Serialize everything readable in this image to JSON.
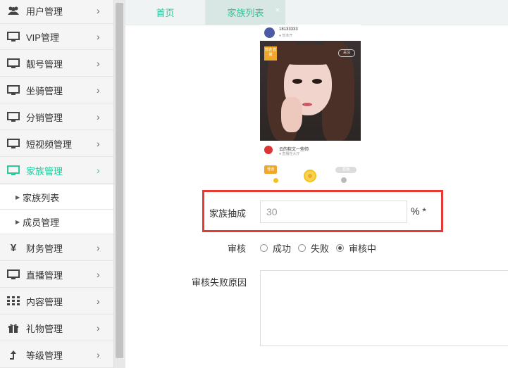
{
  "sidebar": {
    "items": [
      {
        "label": "用户管理",
        "icon": "users-icon"
      },
      {
        "label": "VIP管理",
        "icon": "monitor-icon"
      },
      {
        "label": "靓号管理",
        "icon": "monitor-icon"
      },
      {
        "label": "坐骑管理",
        "icon": "monitor-icon"
      },
      {
        "label": "分销管理",
        "icon": "monitor-icon"
      },
      {
        "label": "短视频管理",
        "icon": "monitor-icon"
      },
      {
        "label": "家族管理",
        "icon": "monitor-icon",
        "active": true
      },
      {
        "label": "财务管理",
        "icon": "yen-icon"
      },
      {
        "label": "直播管理",
        "icon": "monitor-icon"
      },
      {
        "label": "内容管理",
        "icon": "grid-icon"
      },
      {
        "label": "礼物管理",
        "icon": "gift-icon"
      },
      {
        "label": "等级管理",
        "icon": "arrow-up-icon"
      }
    ],
    "sub_items": [
      {
        "label": "家族列表"
      },
      {
        "label": "成员管理"
      }
    ]
  },
  "tabs": [
    {
      "label": "首页"
    },
    {
      "label": "家族列表",
      "close": "×"
    }
  ],
  "preview": {
    "user_name": "18133333",
    "user_sub": "● 暂未开",
    "badge": "普通\n直播",
    "follow": "关注",
    "song_title": "云的软文一些帅",
    "song_sub": "● 直播在大厅",
    "enter": "普通",
    "pill": "直播"
  },
  "form": {
    "commission_label": "家族抽成",
    "commission_value": "30",
    "commission_suffix": "% *",
    "review_label": "审核",
    "review_options": [
      "成功",
      "失败",
      "审核中"
    ],
    "review_selected": "审核中",
    "reject_reason_label": "审核失败原因"
  },
  "colors": {
    "accent": "#2cc79b",
    "highlight": "#e53935"
  }
}
